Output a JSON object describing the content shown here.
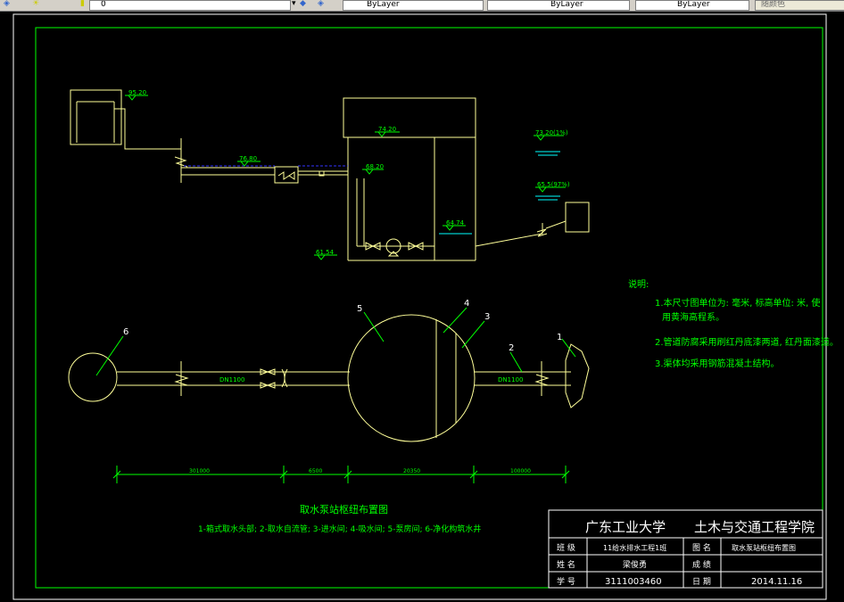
{
  "toolbar": {
    "layer_value": "0",
    "color_value": "ByLayer",
    "linetype_value": "ByLayer",
    "lineweight_value": "ByLayer",
    "plotstyle_value": "随颜色"
  },
  "elevation": {
    "tank_top": "95.20",
    "pipe_level": "76.80",
    "building_top": "74.20",
    "inlet_level": "68.20",
    "water_level": "64.74",
    "bottom_level": "61.54",
    "flood_level": "73.20(1%)",
    "low_level": "65.5(97%)"
  },
  "plan": {
    "labels": [
      "1",
      "2",
      "3",
      "4",
      "5",
      "6"
    ],
    "pipe_left": "DN1100",
    "pipe_right": "DN1100",
    "dims": [
      "301000",
      "6500",
      "20350",
      "100000"
    ]
  },
  "notes": {
    "title": "说明:",
    "items": [
      "1.本尺寸图单位为: 毫米, 标高单位: 米, 使",
      "用黄海高程系。",
      "2.管道防腐采用刷红丹底漆两道, 红丹面漆道。",
      "3.渠体均采用钢筋混凝土结构。"
    ]
  },
  "caption": {
    "title": "取水泵站枢纽布置图",
    "legend": "1-箱式取水头部; 2-取水自流管; 3-进水间; 4-吸水间; 5-泵房间; 6-净化构筑水井"
  },
  "titleblock": {
    "school": "广东工业大学",
    "college": "土木与交通工程学院",
    "class_label": "班 级",
    "class_value": "11给水排水工程1班",
    "drawing_label": "图 名",
    "drawing_value": "取水泵站枢纽布置图",
    "name_label": "姓 名",
    "name_value": "梁俊勇",
    "score_label": "成 绩",
    "score_value": "",
    "id_label": "学 号",
    "id_value": "3111003460",
    "date_label": "日 期",
    "date_value": "2014.11.16"
  },
  "colors": {
    "background": "#000000",
    "frame": "#00ff00",
    "drawing": "#ffff99",
    "annotation": "#00ff00",
    "water": "#00ffff",
    "pipe_hatch": "#3333ff",
    "titleblock": "#ffffff"
  }
}
